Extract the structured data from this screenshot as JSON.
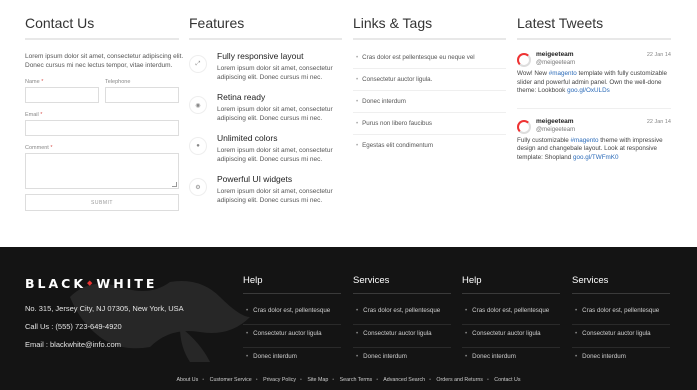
{
  "contact": {
    "title": "Contact Us",
    "intro": "Lorem ipsum dolor sit amet, consectetur adipiscing elit. Donec cursus mi nec lectus tempor, vitae interdum.",
    "name_label": "Name",
    "telephone_label": "Telephone",
    "email_label": "Email",
    "comment_label": "Comment",
    "required_mark": "*",
    "submit_label": "SUBMIT"
  },
  "features": {
    "title": "Features",
    "items": [
      {
        "title": "Fully responsive layout",
        "text": "Lorem ipsum dolor sit amet, consectetur adipiscing elit. Donec cursus mi nec.",
        "icon": "resize-icon",
        "glyph": "⤢"
      },
      {
        "title": "Retina ready",
        "text": "Lorem ipsum dolor sit amet, consectetur adipiscing elit. Donec cursus mi nec.",
        "icon": "eye-icon",
        "glyph": "◉"
      },
      {
        "title": "Unlimited colors",
        "text": "Lorem ipsum dolor sit amet, consectetur adipiscing elit. Donec cursus mi nec.",
        "icon": "drop-icon",
        "glyph": "●"
      },
      {
        "title": "Powerful UI widgets",
        "text": "Lorem ipsum dolor sit amet, consectetur adipiscing elit. Donec cursus mi nec.",
        "icon": "gear-icon",
        "glyph": "⚙"
      }
    ]
  },
  "links": {
    "title": "Links & Tags",
    "items": [
      "Cras dolor est pellentesque eu neque vel",
      "Consectetur auctor ligula.",
      "Donec interdum",
      "Purus non libero faucibus",
      "Egestas elit condimentum"
    ]
  },
  "tweets": {
    "title": "Latest Tweets",
    "items": [
      {
        "name": "meigeeteam",
        "handle": "@meigeeteam",
        "date": "22 Jan 14",
        "pre": "Wow! New ",
        "tag": "#magento",
        "mid": " template with fully customizable slider and powerful admin panel. Own the well-done theme: Lookbook ",
        "link": "goo.gl/OxULDs",
        "post": ""
      },
      {
        "name": "meigeeteam",
        "handle": "@meigeeteam",
        "date": "22 Jan 14",
        "pre": "Fully customizable ",
        "tag": "#magento",
        "mid": " theme with impressive design and changebale layout. Look at responsive template: Shopland ",
        "link": "goo.gl/TWFmK0",
        "post": ""
      }
    ]
  },
  "footer": {
    "logo_left": "BLACK",
    "logo_right": "WHITE",
    "address": "No. 315, Jersey City, NJ 07305, New York, USA",
    "phone": "Call Us : (555) 723-649-4920",
    "email": "Email : blackwhite@info.com",
    "columns": [
      {
        "title": "Help",
        "items": [
          "Cras dolor est, pellentesque",
          "Consectetur auctor ligula",
          "Donec interdum"
        ]
      },
      {
        "title": "Services",
        "items": [
          "Cras dolor est, pellentesque",
          "Consectetur auctor ligula",
          "Donec interdum"
        ]
      },
      {
        "title": "Help",
        "items": [
          "Cras dolor est, pellentesque",
          "Consectetur auctor ligula",
          "Donec interdum"
        ]
      },
      {
        "title": "Services",
        "items": [
          "Cras dolor est, pellentesque",
          "Consectetur auctor ligula",
          "Donec interdum"
        ]
      }
    ],
    "bottom_links": [
      "About Us",
      "Customer Service",
      "Privacy Policy",
      "Site Map",
      "Search Terms",
      "Advanced Search",
      "Orders and Returns",
      "Contact Us"
    ]
  }
}
